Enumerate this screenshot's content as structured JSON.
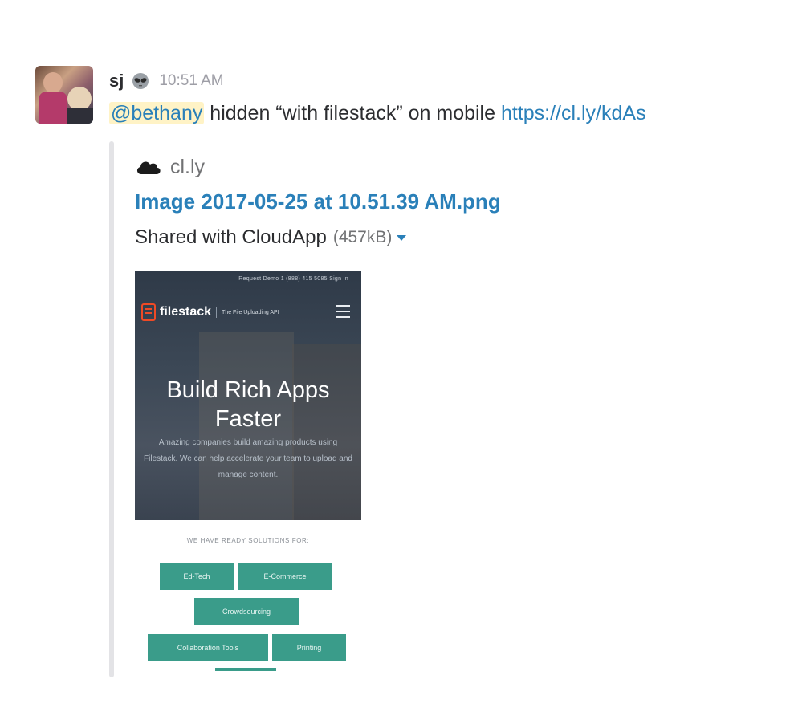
{
  "message": {
    "author": "sj",
    "status_icon": "alien-icon",
    "time": "10:51 AM",
    "mention": "@bethany",
    "text": " hidden “with filestack” on mobile ",
    "link": "https://cl.ly/kdAs"
  },
  "attachment": {
    "service_icon": "cloud-icon",
    "service_name": "cl.ly",
    "title": "Image 2017-05-25 at 10.51.39 AM.png",
    "shared_text": "Shared with CloudApp",
    "size": "(457kB)"
  },
  "preview": {
    "top_links": "Request Demo    1 (888) 415 5085    Sign In",
    "brand": "filestack",
    "tagline": "The File Uploading API",
    "hero_title_line1": "Build Rich Apps",
    "hero_title_line2": "Faster",
    "hero_subtitle": "Amazing companies build amazing products using Filestack. We can help accelerate your team to upload and manage content.",
    "solutions_label": "WE HAVE READY SOLUTIONS FOR:",
    "solutions": [
      "Ed-Tech",
      "E-Commerce",
      "Crowdsourcing",
      "Collaboration Tools",
      "Printing"
    ]
  },
  "colors": {
    "link": "#2a80b9",
    "mention_bg": "#fff3c6",
    "chip": "#3a9c8a",
    "logo": "#ef4a25"
  }
}
